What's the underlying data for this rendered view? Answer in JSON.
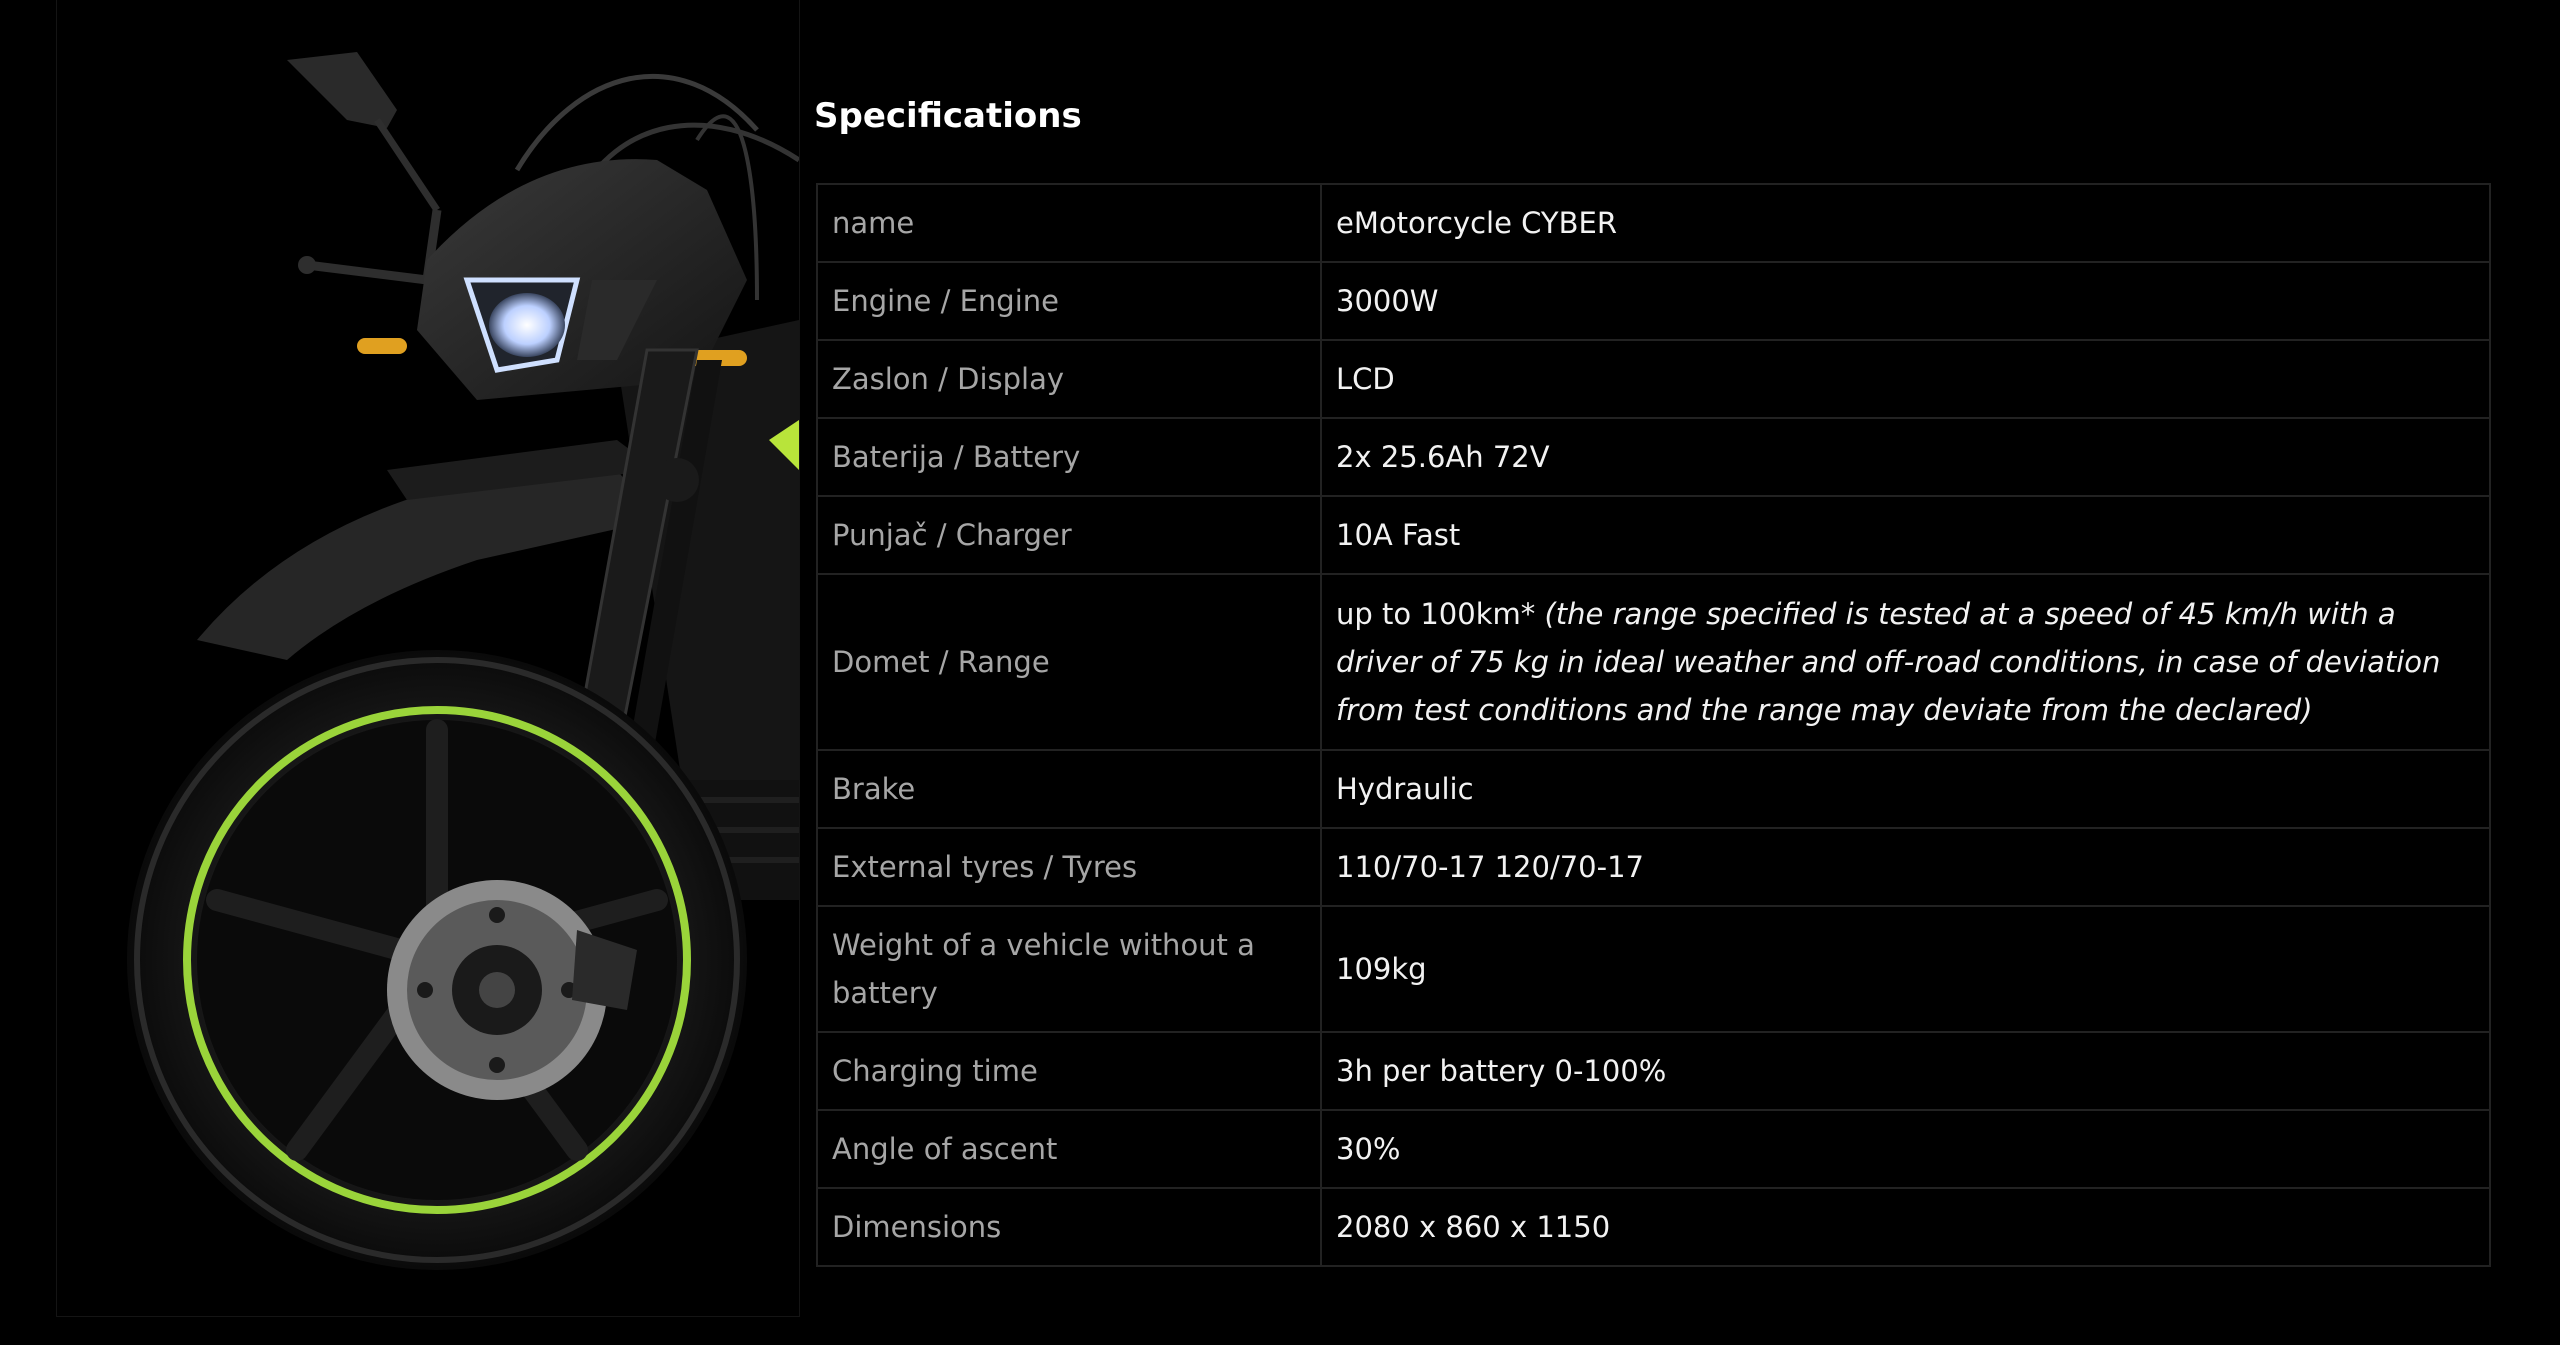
{
  "specifications": {
    "title": "Specifications",
    "rows": [
      {
        "label": "name",
        "value": "eMotorcycle CYBER"
      },
      {
        "label": "Engine / Engine",
        "value": "3000W"
      },
      {
        "label": "Zaslon / Display",
        "value": "LCD"
      },
      {
        "label": "Baterija / Battery",
        "value": "2x 25.6Ah 72V"
      },
      {
        "label": "Punjač / Charger",
        "value": "10A Fast"
      },
      {
        "label": "Domet / Range",
        "value": "up to 100km*",
        "note": "(the range specified is tested at a speed of 45 km/h with a driver of 75 kg in ideal weather and off-road conditions, in case of deviation from test conditions and the range may deviate from the declared)"
      },
      {
        "label": "Brake",
        "value": "Hydraulic"
      },
      {
        "label": "External tyres / Tyres",
        "value": "110/70-17 120/70-17"
      },
      {
        "label": "Weight of a vehicle without a battery",
        "value": "109kg"
      },
      {
        "label": "Charging time",
        "value": "3h per battery 0-100%"
      },
      {
        "label": "Angle of ascent",
        "value": "30%"
      },
      {
        "label": "Dimensions",
        "value": "2080 x 860 x 1150"
      }
    ]
  },
  "colors": {
    "background": "#000000",
    "label_text": "#a6a6a6",
    "value_text": "#f2f2f2",
    "border": "#222222",
    "rim_accent": "#9ad43a"
  }
}
